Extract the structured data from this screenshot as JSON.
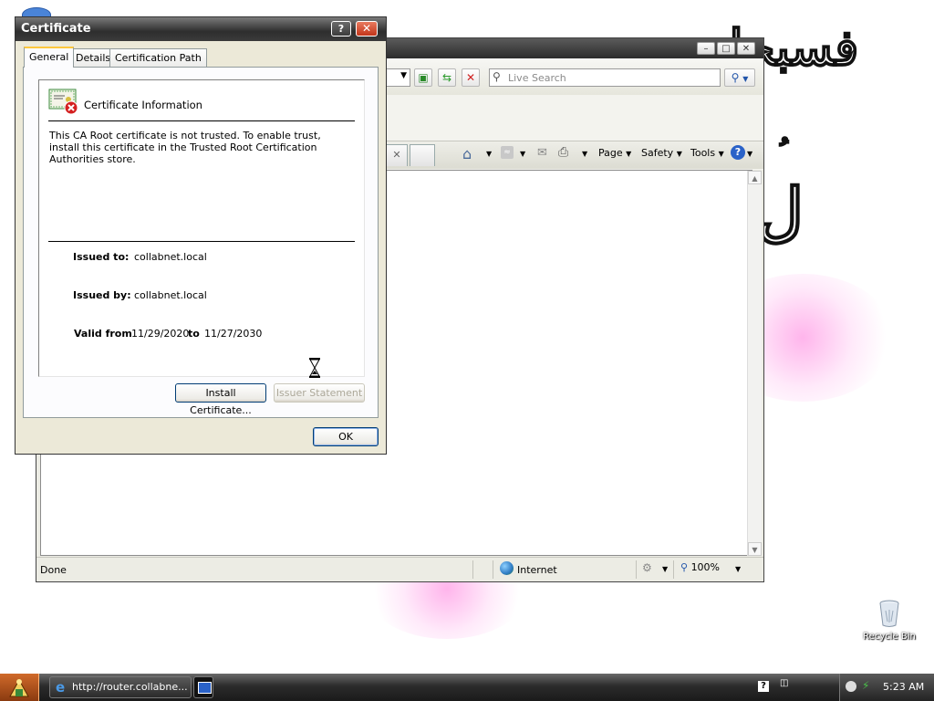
{
  "desktop": {
    "recycle_bin_label": "Recycle Bin"
  },
  "browser": {
    "search_placeholder": "Live Search",
    "command_bar": {
      "page_label": "Page",
      "safety_label": "Safety",
      "tools_label": "Tools"
    },
    "status": {
      "text": "Done",
      "zone": "Internet",
      "zoom": "100%"
    }
  },
  "certificate_dialog": {
    "title": "Certificate",
    "help_glyph": "?",
    "close_glyph": "✕",
    "tabs": [
      {
        "label": "General",
        "active": true
      },
      {
        "label": "Details",
        "active": false
      },
      {
        "label": "Certification Path",
        "active": false
      }
    ],
    "heading": "Certificate Information",
    "warning": "This CA Root certificate is not trusted. To enable trust, install this certificate in the Trusted Root Certification Authorities store.",
    "issued_to_label": "Issued to:",
    "issued_to_value": "collabnet.local",
    "issued_by_label": "Issued by:",
    "issued_by_value": "collabnet.local",
    "valid_from_label": "Valid from",
    "valid_from_value": "11/29/2020",
    "valid_to_label": "to",
    "valid_to_value": "11/27/2030",
    "install_button": "Install Certificate...",
    "issuer_statement_button": "Issuer Statement",
    "ok_button": "OK"
  },
  "taskbar": {
    "task_label": "http://router.collabne...",
    "clock": "5:23 AM"
  },
  "colors": {
    "dialog_bg": "#ece9d8",
    "title_dark": "#2e2e2e",
    "tab_active_accent": "#ffc83c",
    "close_red": "#c2351a"
  }
}
